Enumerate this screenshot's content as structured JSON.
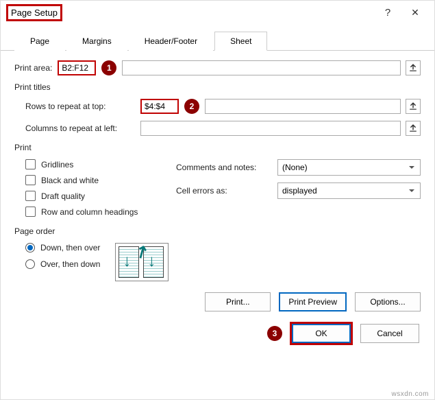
{
  "window": {
    "title": "Page Setup",
    "help": "?",
    "close": "✕"
  },
  "tabs": {
    "page": "Page",
    "margins": "Margins",
    "headerfooter": "Header/Footer",
    "sheet": "Sheet"
  },
  "labels": {
    "print_area": "Print area:",
    "print_titles": "Print titles",
    "rows_repeat": "Rows to repeat at top:",
    "cols_repeat": "Columns to repeat at left:",
    "print": "Print",
    "gridlines": "Gridlines",
    "bw": "Black and white",
    "draft": "Draft quality",
    "rowcolhead": "Row and column headings",
    "comments": "Comments and notes:",
    "cellerrors": "Cell errors as:",
    "page_order": "Page order",
    "down_over": "Down, then over",
    "over_down": "Over, then down"
  },
  "values": {
    "print_area": "B2:F12",
    "rows_repeat": "$4:$4",
    "cols_repeat": "",
    "comments_sel": "(None)",
    "cellerrors_sel": "displayed"
  },
  "buttons": {
    "print": "Print...",
    "preview": "Print Preview",
    "options": "Options...",
    "ok": "OK",
    "cancel": "Cancel"
  },
  "badges": {
    "b1": "1",
    "b2": "2",
    "b3": "3"
  },
  "watermark": "wsxdn.com"
}
